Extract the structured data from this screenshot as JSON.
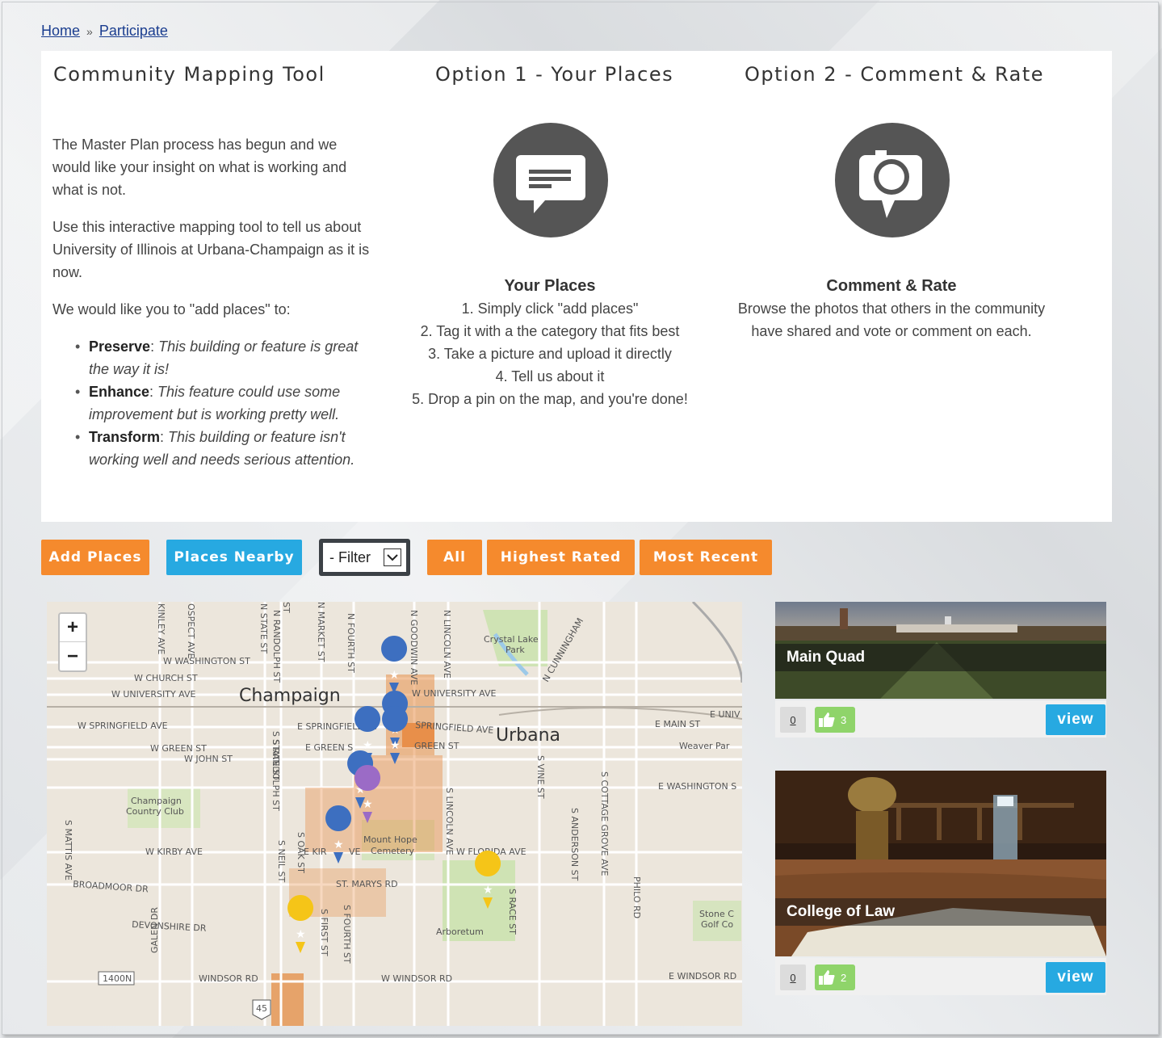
{
  "breadcrumb": {
    "home": "Home",
    "separator": "»",
    "current": "Participate"
  },
  "intro": {
    "title": "Community Mapping Tool",
    "paragraph1": "The Master Plan process has begun and we would like your insight on what is working and what is not.",
    "paragraph2": "Use this interactive mapping tool to tell us about University of Illinois at Urbana-Champaign as it is now.",
    "paragraph3": "We would like you to \"add places\" to:",
    "bullets": [
      {
        "term": "Preserve",
        "text": ": ",
        "desc": "This building or feature is great the way it is!"
      },
      {
        "term": "Enhance",
        "text": ": ",
        "desc": "This feature could use some improvement but is working pretty well."
      },
      {
        "term": "Transform",
        "text": ": ",
        "desc": "This building or feature isn't working well and needs serious attention."
      }
    ]
  },
  "option1": {
    "title": "Option 1 - Your Places",
    "icon": "speech-bubble-icon",
    "heading": "Your Places",
    "steps": [
      "1. Simply click \"add places\"",
      "2. Tag it with a the category that fits best",
      "3. Take a picture and upload it directly",
      "4. Tell us about it",
      "5. Drop a pin on the map, and you're done!"
    ]
  },
  "option2": {
    "title": "Option 2 - Comment & Rate",
    "icon": "camera-icon",
    "heading": "Comment & Rate",
    "line1": "Browse the photos that others in the community",
    "line2": "have shared and vote or comment on each."
  },
  "toolbar": {
    "add_places": "Add Places",
    "places_nearby": "Places Nearby",
    "filter": "- Filter",
    "all": "All",
    "highest_rated": "Highest Rated",
    "most_recent": "Most Recent"
  },
  "colors": {
    "orange": "#f58a2d",
    "blue": "#27a9e1",
    "pin_blue": "#3d6fc0",
    "pin_purple": "#9b6bc6",
    "pin_yellow": "#f5c518"
  },
  "map": {
    "zoom_in": "+",
    "zoom_out": "−",
    "labels": {
      "champaign": "Champaign",
      "urbana": "Urbana",
      "crystal_lake": "Crystal Lake",
      "park": "Park",
      "country_club1": "Champaign",
      "country_club2": "Country Club",
      "cemetery1": "Mount Hope",
      "cemetery2": "Cemetery",
      "arboretum": "Arboretum",
      "weaver": "Weaver Par",
      "stone1": "Stone C",
      "stone2": "Golf Co",
      "w_washington": "W WASHINGTON ST",
      "w_church": "W CHURCH ST",
      "w_university": "W UNIVERSITY AVE",
      "w_springfield": "W SPRINGFIELD AVE",
      "w_green": "W GREEN ST",
      "w_john": "W JOHN ST",
      "e_springfield": "E SPRINGFIELD AV",
      "e_green": "E GREEN S",
      "springfield_ave": "SPRINGFIELD AVE",
      "w_university2": "W UNIVERSITY AVE",
      "e_main": "E MAIN ST",
      "e_univ": "E UNIV",
      "e_washington": "E WASHINGTON S",
      "w_kirby": "W KIRBY AVE",
      "e_kirby": "E KIR",
      "ve": "VE",
      "st_marys": "ST. MARYS RD",
      "w_florida": "W FLORIDA AVE",
      "broadmoor": "BROADMOOR DR",
      "devonshire": "DEVONSHIRE DR",
      "windsor": "WINDSOR RD",
      "w_windsor": "W WINDSOR RD",
      "e_windsor": "E WINDSOR RD",
      "kinley": "KINLEY AVE",
      "prospect": "OSPECT AVE",
      "n_state": "N STATE ST",
      "n_randolph": "N RANDOLPH ST",
      "n_market": "N MARKET ST",
      "n_fourth": "N FOURTH ST",
      "n_goodwin": "N GOODWIN AVE",
      "n_lincoln": "N LINCOLN AVE",
      "n_cunningham": "N CUNNINGHAM",
      "s_state": "S STATE ST",
      "s_randolph": "S RANDOLPH ST",
      "s_lincoln": "S LINCOLN AVE",
      "s_vine": "S VINE ST",
      "s_cottage": "S COTTAGE GROVE AVE",
      "s_anderson": "S ANDERSON ST",
      "philo": "PHILO RD",
      "s_race": "S RACE ST",
      "s_mattis": "S MATTIS AVE",
      "s_neil": "S NEIL ST",
      "s_oak": "S OAK ST",
      "s_first": "S FIRST ST",
      "s_fourth": "S FOURTH ST",
      "galen": "GALEN DR",
      "st_top": "ST",
      "green_st": "GREEN ST",
      "route_1400": "1400N",
      "route_45": "45"
    }
  },
  "places": [
    {
      "name": "Main Quad",
      "comments": "0",
      "likes": "3",
      "view": "view"
    },
    {
      "name": "College of Law",
      "comments": "0",
      "likes": "2",
      "view": "view"
    }
  ]
}
